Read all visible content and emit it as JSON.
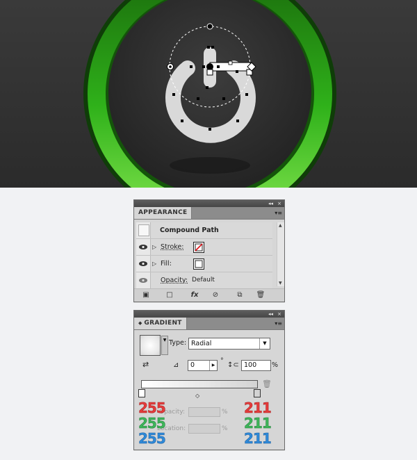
{
  "appearance": {
    "title": "APPEARANCE",
    "item_name": "Compound Path",
    "stroke_label": "Stroke:",
    "fill_label": "Fill:",
    "opacity_label": "Opacity:",
    "opacity_value": "Default"
  },
  "gradient": {
    "title": "GRADIENT",
    "type_label": "Type:",
    "type_value": "Radial",
    "angle_value": "0",
    "degree_symbol": "°",
    "aspect_value": "100",
    "percent": "%",
    "opacity_label": "Opacity:",
    "location_label": "Location:"
  },
  "stops": {
    "left": {
      "r": "255",
      "g": "255",
      "b": "255"
    },
    "right": {
      "r": "211",
      "g": "211",
      "b": "211"
    }
  },
  "panel_controls": {
    "collapse": "◂◂",
    "close": "×",
    "menu": "▾≡"
  },
  "colors": {
    "ring_green": "#39c21f",
    "background_dark": "#2e2e2e",
    "link_blue": "#1a3fd1"
  }
}
